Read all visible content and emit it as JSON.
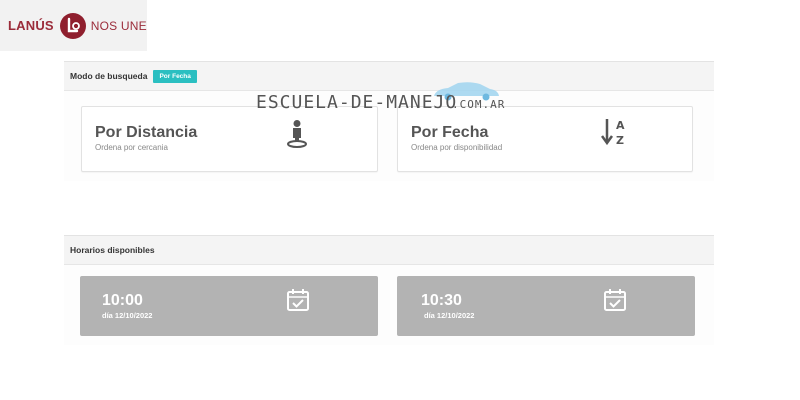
{
  "logo": {
    "left": "LANÚS",
    "right": "NOS UNE"
  },
  "search_mode": {
    "title": "Modo de busqueda",
    "badge": "Por Fecha",
    "options": [
      {
        "title": "Por Distancia",
        "subtitle": "Ordena por cercania",
        "icon": "person-location-icon"
      },
      {
        "title": "Por Fecha",
        "subtitle": "Ordena por disponibilidad",
        "icon": "sort-az-icon"
      }
    ]
  },
  "watermark": {
    "text": "ESCUELA-DE-MANEJO",
    "suffix": ".COM.AR"
  },
  "schedules": {
    "title": "Horarios disponibles",
    "slots": [
      {
        "time": "10:00",
        "date": "día 12/10/2022",
        "icon": "calendar-check-icon"
      },
      {
        "time": "10:30",
        "date": "día 12/10/2022",
        "icon": "calendar-check-icon"
      }
    ]
  },
  "colors": {
    "brand": "#8f1f2e",
    "badge": "#2bbfc1",
    "slot_bg": "#b3b3b3"
  }
}
